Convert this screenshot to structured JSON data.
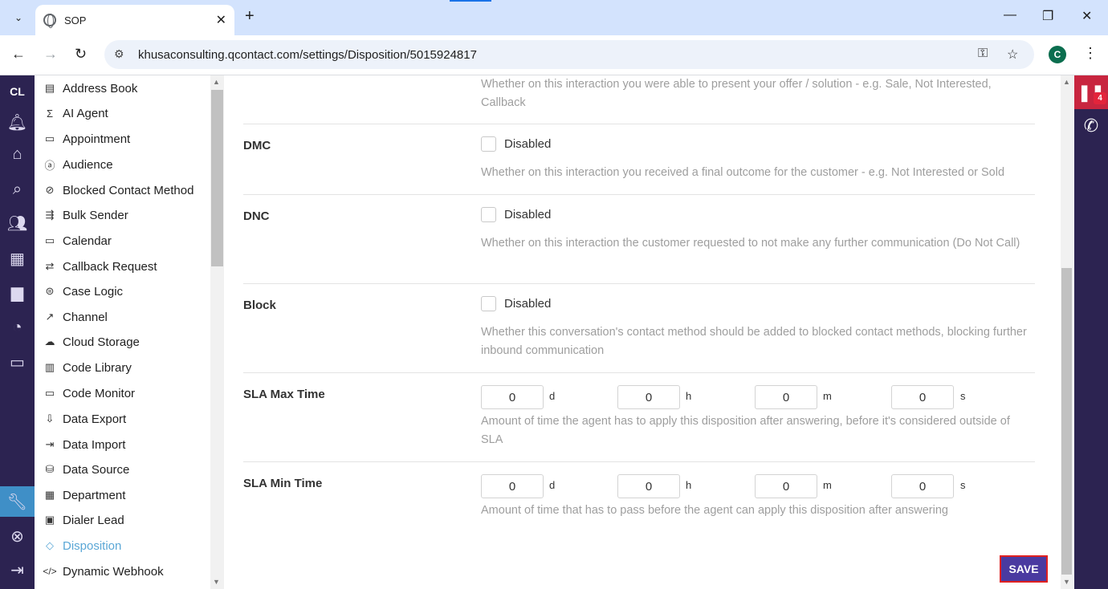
{
  "browser": {
    "tab_title": "SOP",
    "url": "khusaconsulting.qcontact.com/settings/Disposition/5015924817",
    "profile_initial": "C"
  },
  "rail": {
    "logo": "CL",
    "icons": [
      "bell-icon",
      "home-icon",
      "search-icon",
      "users-icon",
      "building-icon",
      "briefcase-icon",
      "pie-chart-icon",
      "monitor-icon",
      "wrench-icon",
      "lifebuoy-icon",
      "logout-icon"
    ]
  },
  "sidebar": {
    "items": [
      {
        "label": "Address Book",
        "icon": "▤"
      },
      {
        "label": "AI Agent",
        "icon": "Σ"
      },
      {
        "label": "Appointment",
        "icon": "▭"
      },
      {
        "label": "Audience",
        "icon": "ⓐ"
      },
      {
        "label": "Blocked Contact Method",
        "icon": "⊘"
      },
      {
        "label": "Bulk Sender",
        "icon": "⇶"
      },
      {
        "label": "Calendar",
        "icon": "▭"
      },
      {
        "label": "Callback Request",
        "icon": "⇄"
      },
      {
        "label": "Case Logic",
        "icon": "⊜"
      },
      {
        "label": "Channel",
        "icon": "↗"
      },
      {
        "label": "Cloud Storage",
        "icon": "☁"
      },
      {
        "label": "Code Library",
        "icon": "▥"
      },
      {
        "label": "Code Monitor",
        "icon": "▭"
      },
      {
        "label": "Data Export",
        "icon": "⇩"
      },
      {
        "label": "Data Import",
        "icon": "⇥"
      },
      {
        "label": "Data Source",
        "icon": "⛁"
      },
      {
        "label": "Department",
        "icon": "▦"
      },
      {
        "label": "Dialer Lead",
        "icon": "▣"
      },
      {
        "label": "Disposition",
        "icon": "◇"
      },
      {
        "label": "Dynamic Webhook",
        "icon": "</>"
      }
    ],
    "active": "Disposition"
  },
  "form": {
    "top_desc": "Whether on this interaction you were able to present your offer / solution - e.g. Sale, Not Interested, Callback",
    "dmc": {
      "label": "DMC",
      "checkbox_label": "Disabled",
      "desc": "Whether on this interaction you received a final outcome for the customer - e.g. Not Interested or Sold"
    },
    "dnc": {
      "label": "DNC",
      "checkbox_label": "Disabled",
      "desc": "Whether on this interaction the customer requested to not make any further communication (Do Not Call)"
    },
    "block": {
      "label": "Block",
      "checkbox_label": "Disabled",
      "desc": "Whether this conversation's contact method should be added to blocked contact methods, blocking further inbound communication"
    },
    "sla_max": {
      "label": "SLA Max Time",
      "values": {
        "d": "0",
        "h": "0",
        "m": "0",
        "s": "0"
      },
      "units": [
        "d",
        "h",
        "m",
        "s"
      ],
      "desc": "Amount of time the agent has to apply this disposition after answering, before it's considered outside of SLA"
    },
    "sla_min": {
      "label": "SLA Min Time",
      "values": {
        "d": "0",
        "h": "0",
        "m": "0",
        "s": "0"
      },
      "units": [
        "d",
        "h",
        "m",
        "s"
      ],
      "desc": "Amount of time that has to pass before the agent can apply this disposition after answering"
    },
    "save_label": "SAVE"
  },
  "widget": {
    "badge_count": "4"
  },
  "colors": {
    "rail_bg": "#2c2351",
    "active_link": "#5aa7d6",
    "save_bg": "#4a3aa0",
    "pause_bg": "#c8253f"
  }
}
